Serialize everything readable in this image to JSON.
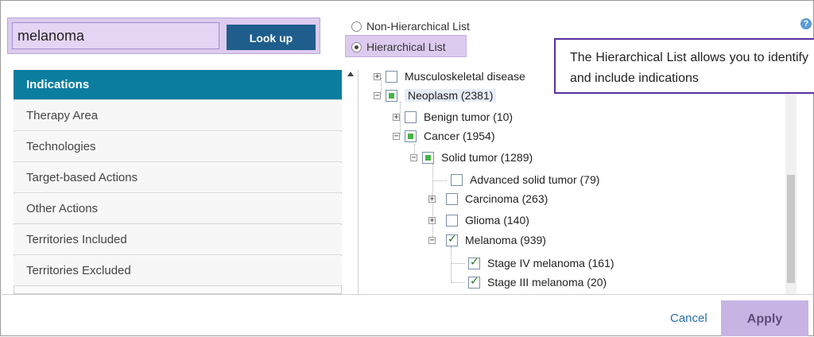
{
  "search": {
    "value": "melanoma",
    "button_label": "Look up"
  },
  "nav": {
    "items": [
      {
        "label": "Indications",
        "active": true
      },
      {
        "label": "Therapy Area"
      },
      {
        "label": "Technologies"
      },
      {
        "label": "Target-based Actions"
      },
      {
        "label": "Other Actions"
      },
      {
        "label": "Territories Included"
      },
      {
        "label": "Territories Excluded"
      }
    ]
  },
  "list_mode": {
    "options": [
      {
        "label": "Non-Hierarchical List",
        "selected": false
      },
      {
        "label": "Hierarchical List",
        "selected": true
      }
    ]
  },
  "tree": {
    "nodes": [
      {
        "label": "Musculoskeletal disease",
        "expander": "+",
        "check": "none"
      },
      {
        "label": "Neoplasm (2381)",
        "expander": "−",
        "check": "partial",
        "highlighted": true
      },
      {
        "label": "Benign tumor (10)",
        "expander": "+",
        "check": "none"
      },
      {
        "label": "Cancer (1954)",
        "expander": "−",
        "check": "partial"
      },
      {
        "label": "Solid tumor (1289)",
        "expander": "−",
        "check": "partial"
      },
      {
        "label": "Advanced solid tumor (79)",
        "expander": "",
        "check": "none"
      },
      {
        "label": "Carcinoma (263)",
        "expander": "+",
        "check": "none"
      },
      {
        "label": "Glioma (140)",
        "expander": "+",
        "check": "none"
      },
      {
        "label": "Melanoma (939)",
        "expander": "−",
        "check": "checked"
      },
      {
        "label": "Stage IV melanoma (161)",
        "expander": "",
        "check": "checked"
      },
      {
        "label": "Stage III melanoma (20)",
        "expander": "",
        "check": "checked"
      }
    ]
  },
  "callout": {
    "text": "The Hierarchical List allows you to identify and include indications"
  },
  "footer": {
    "cancel_label": "Cancel",
    "apply_label": "Apply"
  },
  "help": {
    "icon": "question-icon",
    "glyph": "?"
  },
  "colors": {
    "accent": "#0b7ea0",
    "lookup": "#1f5e8c",
    "highlight": "#dccbef",
    "callout_border": "#5b2fa0"
  }
}
